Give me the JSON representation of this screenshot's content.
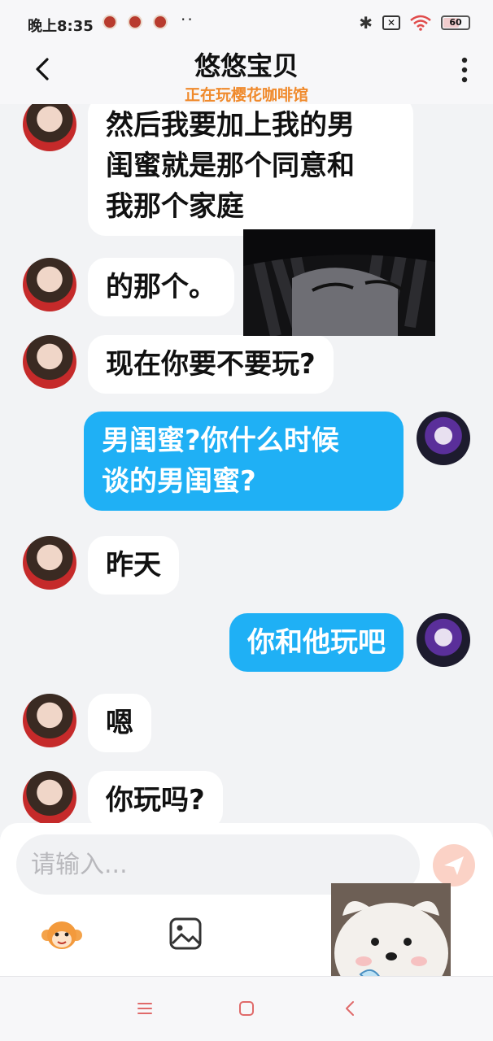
{
  "status_bar": {
    "time": "晚上8:35",
    "dots": "··",
    "battery": "60"
  },
  "header": {
    "title": "悠悠宝贝",
    "subtitle": "正在玩樱花咖啡馆"
  },
  "messages": [
    {
      "side": "in",
      "text": "然后我要加上我的男\n闺蜜就是那个同意和\n我那个家庭"
    },
    {
      "side": "in",
      "text": "的那个。"
    },
    {
      "side": "in",
      "text": "现在你要不要玩?"
    },
    {
      "side": "out",
      "text": "男闺蜜?你什么时候\n谈的男闺蜜?"
    },
    {
      "side": "in",
      "text": "昨天"
    },
    {
      "side": "out",
      "text": "你和他玩吧"
    },
    {
      "side": "in",
      "text": "嗯"
    },
    {
      "side": "in",
      "text": "你玩吗?"
    }
  ],
  "input": {
    "placeholder": "请输入..."
  },
  "icons": {
    "back": "chevron-left-icon",
    "more": "more-vertical-icon",
    "send": "send-icon",
    "emoji": "monkey-emoji-icon",
    "image": "image-icon",
    "nav_menu": "menu-icon",
    "nav_home": "home-square-icon",
    "nav_back": "back-triangle-icon"
  },
  "colors": {
    "outgoing_bubble": "#1fb0f5",
    "incoming_bubble": "#ffffff",
    "subtitle": "#f08a2c",
    "send_button": "#fbd2c6",
    "background": "#f2f3f5"
  }
}
